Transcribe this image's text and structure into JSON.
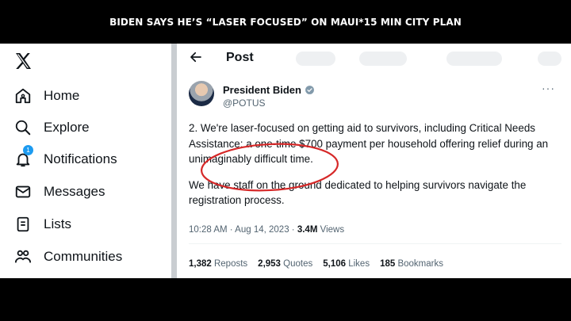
{
  "banner": {
    "headline": "BIDEN SAYS HE’S “LASER FOCUSED” ON MAUI*15 MIN CITY PLAN"
  },
  "sidebar": {
    "items": [
      {
        "label": "Home",
        "icon": "home-icon"
      },
      {
        "label": "Explore",
        "icon": "search-icon"
      },
      {
        "label": "Notifications",
        "icon": "bell-icon",
        "badge": "1"
      },
      {
        "label": "Messages",
        "icon": "mail-icon"
      },
      {
        "label": "Lists",
        "icon": "list-icon"
      },
      {
        "label": "Communities",
        "icon": "communities-icon"
      }
    ]
  },
  "header": {
    "title": "Post"
  },
  "post": {
    "author_name": "President Biden",
    "author_handle": "@POTUS",
    "more": "···",
    "paragraphs": [
      "2. We're laser-focused on getting aid to survivors, including Critical Needs Assistance: a one-time $700 payment per household offering relief during an unimaginably difficult time.",
      "We have staff on the ground dedicated to helping survivors navigate the registration process."
    ],
    "time": "10:28 AM · Aug 14, 2023 · ",
    "views_count": "3.4M",
    "views_label": " Views",
    "stats": {
      "reposts_count": "1,382",
      "reposts_label": "Reposts",
      "quotes_count": "2,953",
      "quotes_label": "Quotes",
      "likes_count": "5,106",
      "likes_label": "Likes",
      "bookmarks_count": "185",
      "bookmarks_label": "Bookmarks"
    }
  },
  "colors": {
    "accent": "#1d9bf0",
    "annotation": "#d62828",
    "divider": "#c9cdd1"
  }
}
